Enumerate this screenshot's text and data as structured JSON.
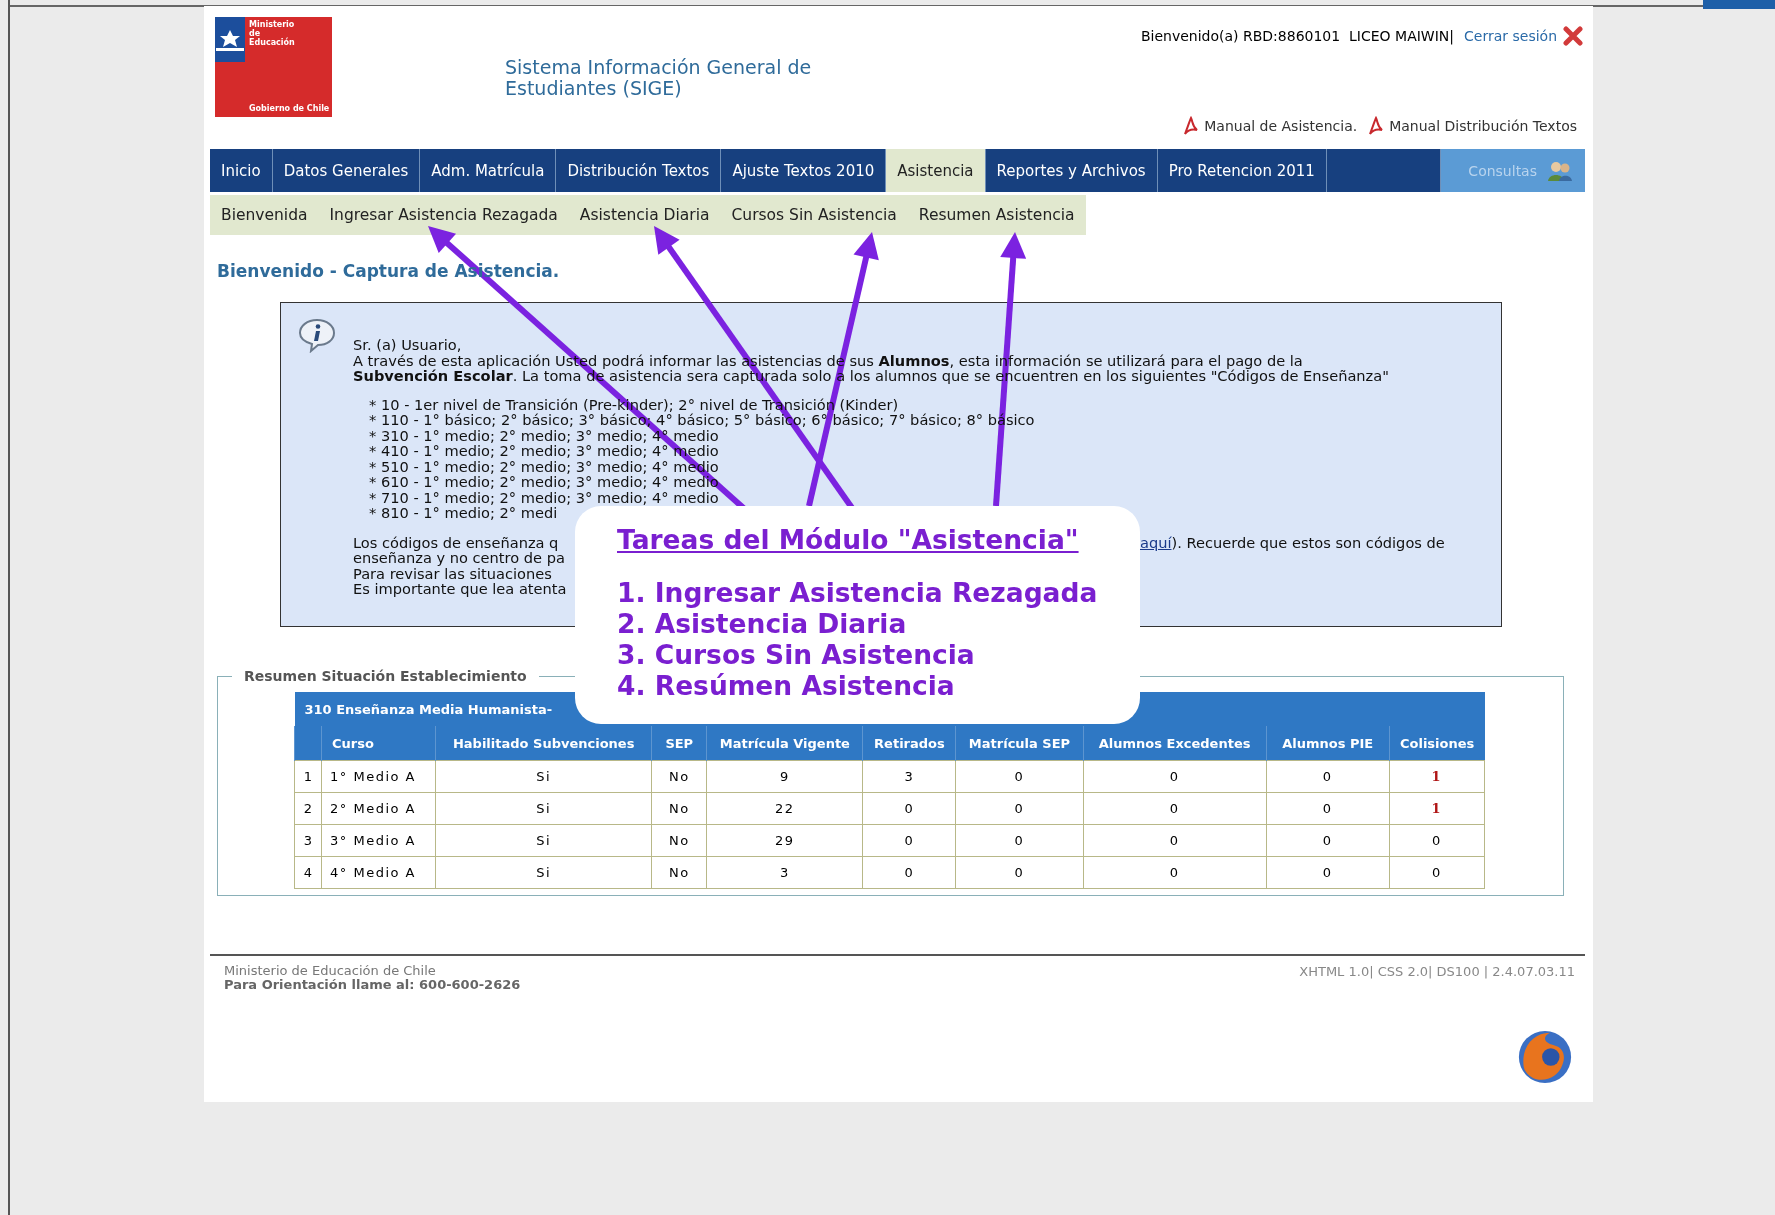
{
  "header": {
    "logo": {
      "ministry": "Ministerio de Educación",
      "government": "Gobierno de Chile"
    },
    "title_lines": [
      "Sistema Información General de",
      "Estudiantes (SIGE)"
    ],
    "welcome": "Bienvenido(a) RBD:8860101  LICEO MAIWIN|",
    "logout": "Cerrar sesión",
    "manuals": [
      "Manual de Asistencia.",
      "Manual Distribución Textos"
    ]
  },
  "nav": [
    {
      "label": "Inicio",
      "kind": "tab",
      "selected": false
    },
    {
      "label": "Datos Generales",
      "kind": "tab",
      "selected": false
    },
    {
      "label": "Adm. Matrícula",
      "kind": "tab",
      "selected": false
    },
    {
      "label": "Distribución Textos",
      "kind": "tab",
      "selected": false
    },
    {
      "label": "Ajuste Textos 2010",
      "kind": "tab",
      "selected": false
    },
    {
      "label": "Asistencia",
      "kind": "tab",
      "selected": true
    },
    {
      "label": "Reportes y Archivos",
      "kind": "tab",
      "selected": false
    },
    {
      "label": "Pro Retencion 2011",
      "kind": "tab",
      "selected": false
    },
    {
      "label": "Consultas",
      "kind": "query",
      "selected": false
    }
  ],
  "subnav": [
    {
      "label": "Bienvenida",
      "selected": false
    },
    {
      "label": "Ingresar Asistencia Rezagada",
      "selected": false
    },
    {
      "label": "Asistencia Diaria",
      "selected": false
    },
    {
      "label": "Cursos Sin Asistencia",
      "selected": false
    },
    {
      "label": "Resumen Asistencia",
      "selected": false
    }
  ],
  "heading": "Bienvenido - Captura de Asistencia.",
  "info": {
    "greeting": "Sr. (a) Usuario,",
    "intro_lines": [
      "A través de esta aplicación Usted podrá informar las asistencias de sus **Alumnos**, esta información se utilizará para el pago de la",
      "**Subvención Escolar**. La toma de asistencia sera capturada solo a los alumnos que se encuentren en los siguientes \"Códigos de Enseñanza\""
    ],
    "codes": [
      "* 10 - 1er nivel de Transición (Pre-kinder); 2° nivel de Transición (Kinder)",
      "* 110 - 1° básico; 2° básico; 3° básico; 4° básico; 5° básico; 6° básico; 7° básico; 8° básico",
      "* 310 - 1° medio; 2° medio; 3° medio; 4° medio",
      "* 410 - 1° medio; 2° medio; 3° medio; 4° medio",
      "* 510 - 1° medio; 2° medio; 3° medio; 4° medio",
      "* 610 - 1° medio; 2° medio; 3° medio; 4° medio",
      "* 710 - 1° medio; 2° medio; 3° medio; 4° medio",
      "* 810 - 1° medio; 2° medi"
    ],
    "notes": [
      "Los códigos de enseñanza q",
      "enseñanza y no centro de pa",
      "Para revisar las situaciones",
      "Es importante que lea atenta"
    ],
    "note_link": "aquí",
    "note_after": "). Recuerde que estos son códigos de"
  },
  "callout": {
    "title": "Tareas del Módulo \"Asistencia\"",
    "items": [
      "1. Ingresar Asistencia Rezagada",
      "2. Asistencia Diaria",
      "3. Cursos Sin Asistencia",
      "4. Resúmen Asistencia"
    ]
  },
  "summary": {
    "legend": "Resumen Situación Establecimiento",
    "table_title": "310 Enseñanza Media Humanista-",
    "columns": [
      "Curso",
      "Habilitado Subvenciones",
      "SEP",
      "Matrícula Vigente",
      "Retirados",
      "Matrícula SEP",
      "Alumnos Excedentes",
      "Alumnos PIE",
      "Colisiones"
    ],
    "rows": [
      {
        "index": "1",
        "cells": [
          "1° Medio A",
          "Si",
          "No",
          "9",
          "3",
          "0",
          "0",
          "0"
        ],
        "collisions": "1",
        "alert": true
      },
      {
        "index": "2",
        "cells": [
          "2° Medio A",
          "Si",
          "No",
          "22",
          "0",
          "0",
          "0",
          "0"
        ],
        "collisions": "1",
        "alert": true
      },
      {
        "index": "3",
        "cells": [
          "3° Medio A",
          "Si",
          "No",
          "29",
          "0",
          "0",
          "0",
          "0"
        ],
        "collisions": "0",
        "alert": false
      },
      {
        "index": "4",
        "cells": [
          "4° Medio A",
          "Si",
          "No",
          "3",
          "0",
          "0",
          "0",
          "0"
        ],
        "collisions": "0",
        "alert": false
      }
    ]
  },
  "footer": {
    "ministry": "Ministerio de Educación de Chile",
    "contact": "Para Orientación llame al: 600-600-2626",
    "validators": "XHTML 1.0| CSS 2.0| DS100 | 2.4.07.03.11"
  }
}
